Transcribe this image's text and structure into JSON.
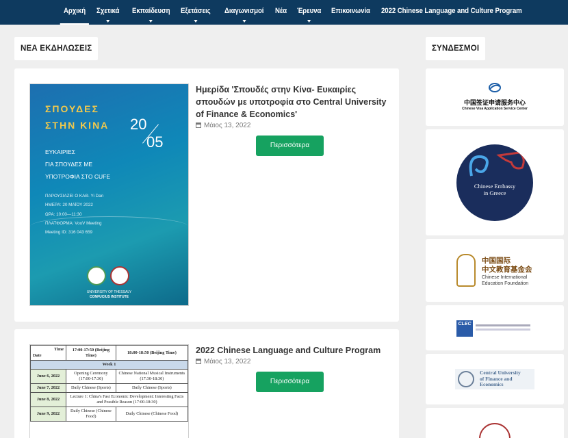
{
  "nav": {
    "items": [
      {
        "label": "Αρχική",
        "has_dropdown": false,
        "active": true
      },
      {
        "label": "Σχετικά",
        "has_dropdown": true,
        "active": false
      },
      {
        "label": "Εκπαίδευση",
        "has_dropdown": true,
        "active": false
      },
      {
        "label": "Εξετάσεις",
        "has_dropdown": true,
        "active": false
      },
      {
        "label": "Διαγωνισμοί",
        "has_dropdown": true,
        "active": false
      },
      {
        "label": "Νέα",
        "has_dropdown": false,
        "active": false
      },
      {
        "label": "Έρευνα",
        "has_dropdown": true,
        "active": false
      },
      {
        "label": "Επικοινωνία",
        "has_dropdown": false,
        "active": false
      },
      {
        "label": "2022 Chinese Language and Culture Program",
        "has_dropdown": false,
        "active": false
      }
    ]
  },
  "main": {
    "section_title": "ΝΕΑ ΕΚΔΗΛΩΣΕΙΣ",
    "posts": [
      {
        "title": "Ημερίδα 'Σπουδές στην Κίνα- Ευκαιρίες σπουδών με υποτροφία στο Central University of Finance & Economics'",
        "date": "Μάιος 13, 2022",
        "button": "Περισσότερα",
        "poster": {
          "heading_1": "ΣΠΟΥΔΕΣ",
          "heading_2": "ΣΤΗΝ ΚΙΝΑ",
          "date_day": "20",
          "date_month": "05",
          "sub_1": "ΕΥΚΑΙΡΙΕΣ",
          "sub_2": "ΓΙΑ ΣΠΟΥΔΕΣ ΜΕ",
          "sub_3": "ΥΠΟΤΡΟΦΙΑ ΣΤΟ CUFE",
          "info": [
            "ΠΑΡΟΥΣΙΑΖΕΙ Ο ΚΑΘ. Yi Dan",
            "ΗΜΕΡΑ: 20 ΜΑΪΟΥ 2022",
            "ΩΡΑ: 10:00—11:30",
            "ΠΛΑΤΦΟΡΜΑ: VooV Meeting",
            "Meeting ID: 316 043 659"
          ],
          "footer_1": "UNIVERSITY OF THESSALY",
          "footer_2": "CONFUCIUS INSTITUTE"
        }
      },
      {
        "title": "2022 Chinese Language and Culture Program",
        "date": "Μάιος 13, 2022",
        "button": "Περισσότερα",
        "schedule": {
          "h_time": "Time",
          "h_date": "Date",
          "h_col1": "17:00-17:50 (Beijing Time)",
          "h_col2": "18:00-18:50 (Beijing Time)",
          "week": "Week 1",
          "rows": [
            {
              "date": "June 6, 2022",
              "c1": "Opening Ceremony (17:00-17:30)",
              "c2": "Chinese National Musical Instruments (17:30-18:30)"
            },
            {
              "date": "June 7, 2022",
              "c1": "Daily Chinese (Sports)",
              "c2": "Daily Chinese (Sports)"
            },
            {
              "date": "June 8, 2022",
              "span": "Lecture 1: China's Fast Economic Development: Interesting Facts and Possible Reason (17:00-18:30)"
            },
            {
              "date": "June 9, 2022",
              "c1": "Daily Chinese (Chinese Food)",
              "c2": "Daily Chinese (Chinese Food)"
            }
          ]
        }
      }
    ]
  },
  "sidebar": {
    "section_title": "ΣΥΝΔΕΣΜΟΙ",
    "links": [
      {
        "cn": "中国签证申请服务中心",
        "en": "Chinese Visa Application Service Center"
      },
      {
        "label_1": "Chinese Embassy",
        "label_2": "in Greece"
      },
      {
        "cn_1": "中国国际",
        "cn_2": "中文教育基金会",
        "en_1": "Chinese International",
        "en_2": "Education Foundation"
      },
      {
        "logo": "CLEC"
      },
      {
        "en_1": "Central University",
        "en_2": "of Finance and",
        "en_3": "Economics"
      },
      {}
    ]
  },
  "colors": {
    "nav_bg": "#0e3a5f",
    "button": "#16a260",
    "page_bg": "#efefef",
    "poster_heading": "#f2c94c",
    "embassy_circle": "#1a2d5c"
  }
}
